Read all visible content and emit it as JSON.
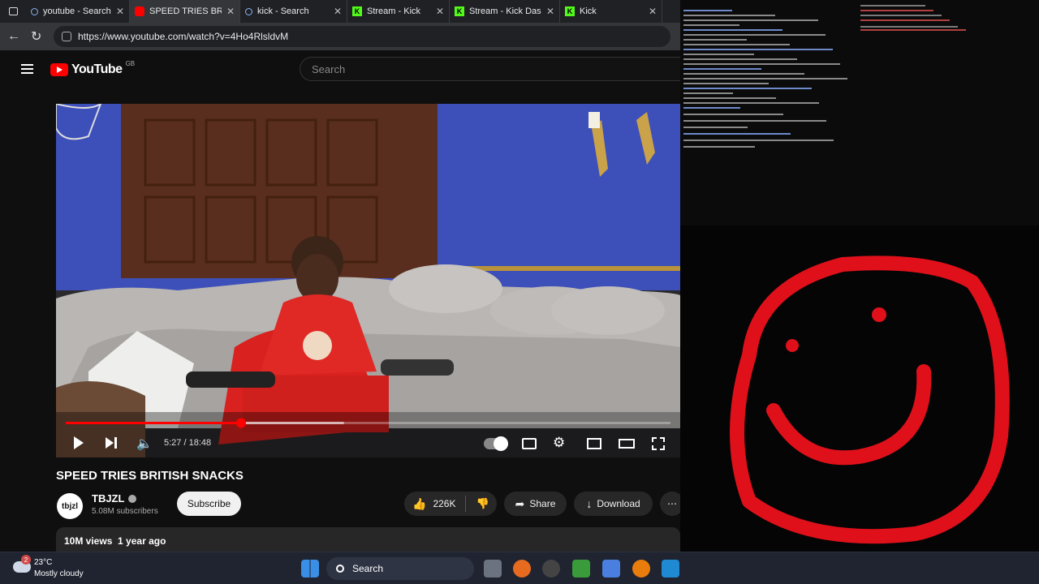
{
  "tabs": [
    {
      "label": "youtube - Search",
      "favicon": "search-icon",
      "active": false
    },
    {
      "label": "SPEED TRIES BRIT",
      "favicon": "youtube-icon",
      "active": true
    },
    {
      "label": "kick - Search",
      "favicon": "search-icon",
      "active": false
    },
    {
      "label": "Stream - Kick",
      "favicon": "kick-icon",
      "active": false
    },
    {
      "label": "Stream - Kick Das",
      "favicon": "kick-icon",
      "active": false
    },
    {
      "label": "Kick",
      "favicon": "kick-icon",
      "active": false
    }
  ],
  "address": {
    "url": "https://www.youtube.com/watch?v=4Ho4RlsldvM"
  },
  "youtube": {
    "logo_text": "YouTube",
    "region": "GB",
    "search_placeholder": "Search"
  },
  "player": {
    "time": "5:27 / 18:48",
    "progress_fraction": 0.29,
    "buffer_fraction": 0.46
  },
  "video": {
    "title": "SPEED TRIES BRITISH SNACKS",
    "channel_avatar": "tbjzl",
    "channel_name": "TBJZL",
    "subscribers": "5.08M subscribers",
    "subscribe_label": "Subscribe",
    "likes": "226K",
    "share_label": "Share",
    "download_label": "Download",
    "meta": "10M views  1 year ago"
  },
  "taskbar": {
    "weather_temp": "23°C",
    "weather_desc": "Mostly cloudy",
    "weather_badge": "2",
    "search_label": "Search"
  },
  "colors": {
    "accent": "#ff0000",
    "kick_green": "#53fc18",
    "smiley": "#e0101a"
  }
}
